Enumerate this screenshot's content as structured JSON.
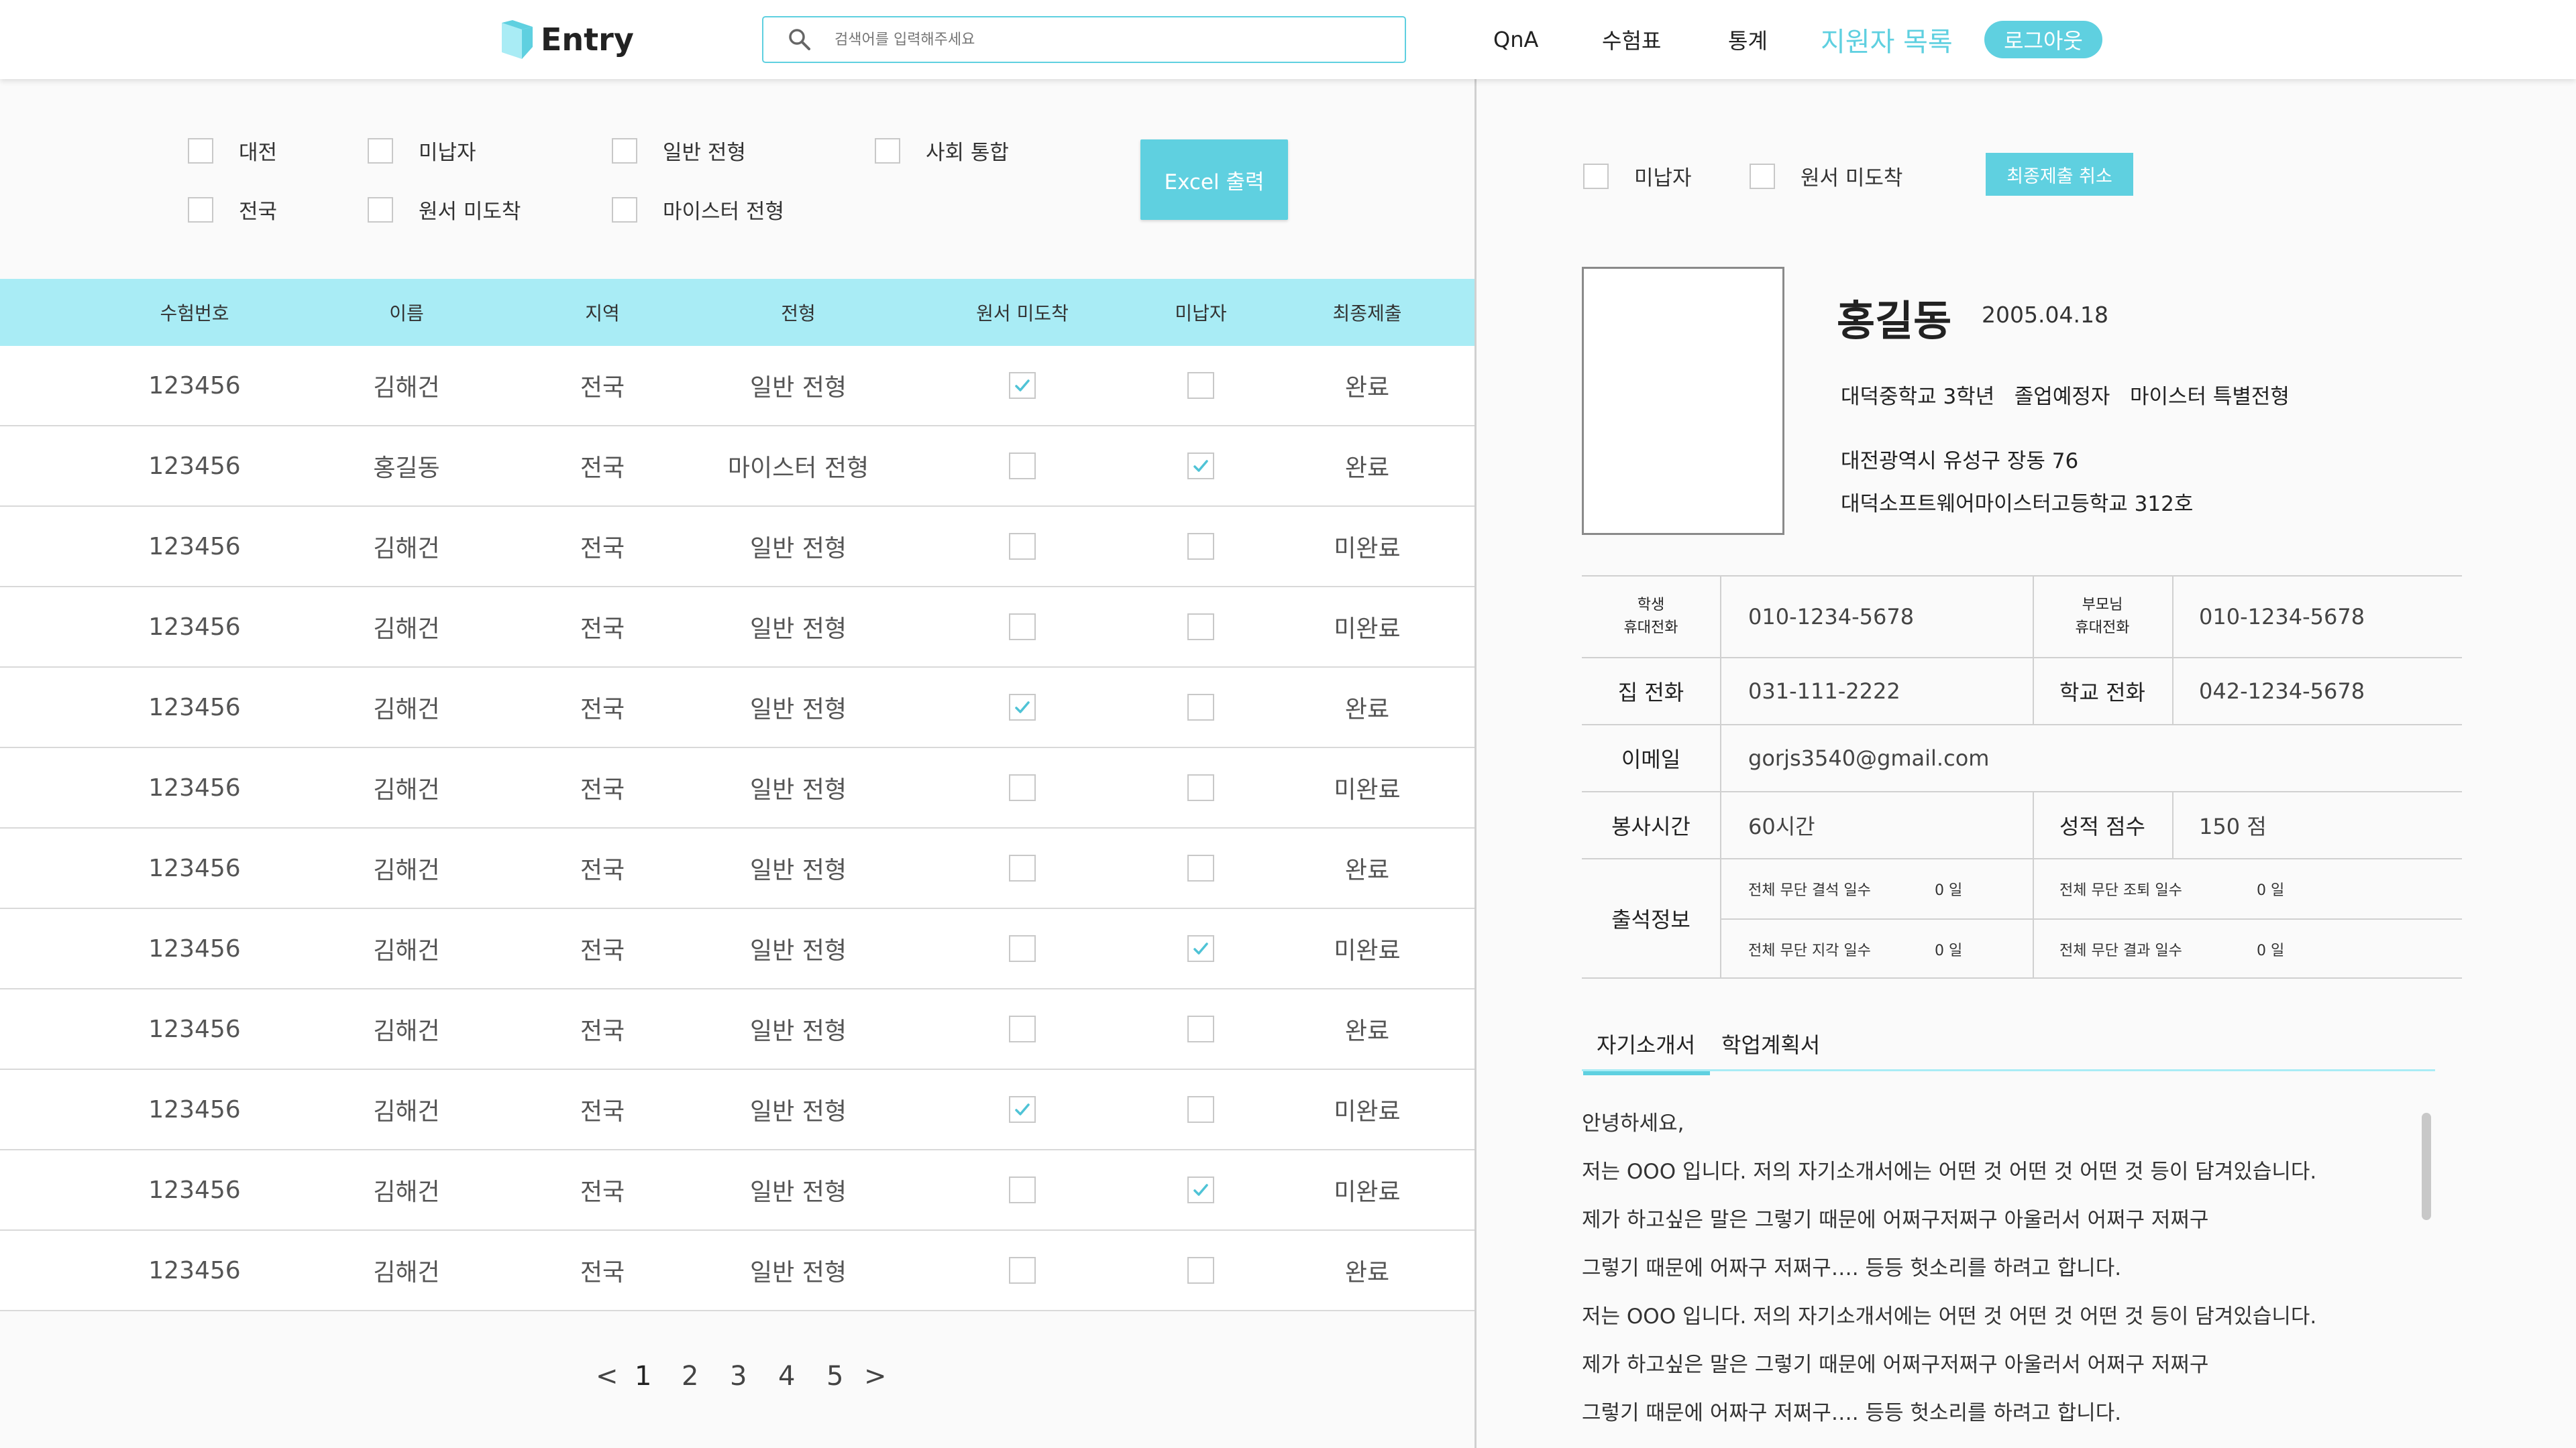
{
  "header": {
    "logo_text": "Entry",
    "search_placeholder": "검색어를 입력해주세요",
    "nav": {
      "qna": "QnA",
      "exam_table": "수험표",
      "stats": "통계",
      "applicants": "지원자 목록",
      "logout": "로그아웃"
    },
    "colors": {
      "accent": "#5fd0e0",
      "table_header": "#a9ecf5"
    }
  },
  "filters": [
    {
      "label": "대전",
      "checked": false
    },
    {
      "label": "미납자",
      "checked": false
    },
    {
      "label": "일반 전형",
      "checked": false
    },
    {
      "label": "사회 통합",
      "checked": false
    },
    {
      "label": "전국",
      "checked": false
    },
    {
      "label": "원서 미도착",
      "checked": false
    },
    {
      "label": "마이스터 전형",
      "checked": false
    }
  ],
  "excel_button": "Excel 출력",
  "table": {
    "headers": [
      "수험번호",
      "이름",
      "지역",
      "전형",
      "원서 미도착",
      "미납자",
      "최종제출"
    ],
    "rows": [
      {
        "id": "123456",
        "name": "김해건",
        "region": "전국",
        "type": "일반 전형",
        "not_arrived": true,
        "unpaid": false,
        "final": "완료"
      },
      {
        "id": "123456",
        "name": "홍길동",
        "region": "전국",
        "type": "마이스터 전형",
        "not_arrived": false,
        "unpaid": true,
        "final": "완료"
      },
      {
        "id": "123456",
        "name": "김해건",
        "region": "전국",
        "type": "일반 전형",
        "not_arrived": false,
        "unpaid": false,
        "final": "미완료"
      },
      {
        "id": "123456",
        "name": "김해건",
        "region": "전국",
        "type": "일반 전형",
        "not_arrived": false,
        "unpaid": false,
        "final": "미완료"
      },
      {
        "id": "123456",
        "name": "김해건",
        "region": "전국",
        "type": "일반 전형",
        "not_arrived": true,
        "unpaid": false,
        "final": "완료"
      },
      {
        "id": "123456",
        "name": "김해건",
        "region": "전국",
        "type": "일반 전형",
        "not_arrived": false,
        "unpaid": false,
        "final": "미완료"
      },
      {
        "id": "123456",
        "name": "김해건",
        "region": "전국",
        "type": "일반 전형",
        "not_arrived": false,
        "unpaid": false,
        "final": "완료"
      },
      {
        "id": "123456",
        "name": "김해건",
        "region": "전국",
        "type": "일반 전형",
        "not_arrived": false,
        "unpaid": true,
        "final": "미완료"
      },
      {
        "id": "123456",
        "name": "김해건",
        "region": "전국",
        "type": "일반 전형",
        "not_arrived": false,
        "unpaid": false,
        "final": "완료"
      },
      {
        "id": "123456",
        "name": "김해건",
        "region": "전국",
        "type": "일반 전형",
        "not_arrived": true,
        "unpaid": false,
        "final": "미완료"
      },
      {
        "id": "123456",
        "name": "김해건",
        "region": "전국",
        "type": "일반 전형",
        "not_arrived": false,
        "unpaid": true,
        "final": "미완료"
      },
      {
        "id": "123456",
        "name": "김해건",
        "region": "전국",
        "type": "일반 전형",
        "not_arrived": false,
        "unpaid": false,
        "final": "완료"
      }
    ]
  },
  "pagination": {
    "prev": "<",
    "pages": [
      "1",
      "2",
      "3",
      "4",
      "5"
    ],
    "current": "1",
    "next": ">"
  },
  "detail": {
    "filters": [
      {
        "label": "미납자",
        "checked": false
      },
      {
        "label": "원서 미도착",
        "checked": false
      }
    ],
    "cancel_button": "최종제출 취소",
    "name": "홍길동",
    "birth": "2005.04.18",
    "school_line": "대덕중학교 3학년   졸업예정자   마이스터 특별전형",
    "address": "대전광역시 유성구 장동 76",
    "address2": "대덕소프트웨어마이스터고등학교 312호",
    "student_phone_label_1": "학생",
    "student_phone_label_2": "휴대전화",
    "student_phone": "010-1234-5678",
    "parent_phone_label_1": "부모님",
    "parent_phone_label_2": "휴대전화",
    "parent_phone": "010-1234-5678",
    "home_phone_label": "집 전화",
    "home_phone": "031-111-2222",
    "school_phone_label": "학교 전화",
    "school_phone": "042-1234-5678",
    "email_label": "이메일",
    "email": "gorjs3540@gmail.com",
    "volunteer_label": "봉사시간",
    "volunteer": "60시간",
    "grade_label": "성적 점수",
    "grade": "150 점",
    "attendance_label": "출석정보",
    "absence_label": "전체 무단 결석 일수",
    "absence": "0 일",
    "early_leave_label": "전체 무단 조퇴 일수",
    "early_leave": "0 일",
    "late_label": "전체 무단 지각 일수",
    "late": "0 일",
    "missed_class_label": "전체 무단 결과 일수",
    "missed_class": "0 일",
    "tabs": [
      "자기소개서",
      "학업계획서"
    ],
    "essay": [
      "안녕하세요,",
      "저는 OOO 입니다. 저의 자기소개서에는 어떤 것 어떤 것 어떤 것 등이 담겨있습니다.",
      "제가 하고싶은 말은 그렇기 때문에 어쩌구저쩌구 아울러서 어쩌구 저쩌구",
      "그렇기 때문에 어짜구 저쩌구…. 등등  헛소리를 하려고 합니다.",
      "저는 OOO 입니다. 저의 자기소개서에는 어떤 것 어떤 것 어떤 것 등이 담겨있습니다.",
      "제가 하고싶은 말은 그렇기 때문에 어쩌구저쩌구 아울러서 어쩌구 저쩌구",
      "그렇기 때문에 어짜구 저쩌구…. 등등  헛소리를 하려고 합니다."
    ]
  }
}
